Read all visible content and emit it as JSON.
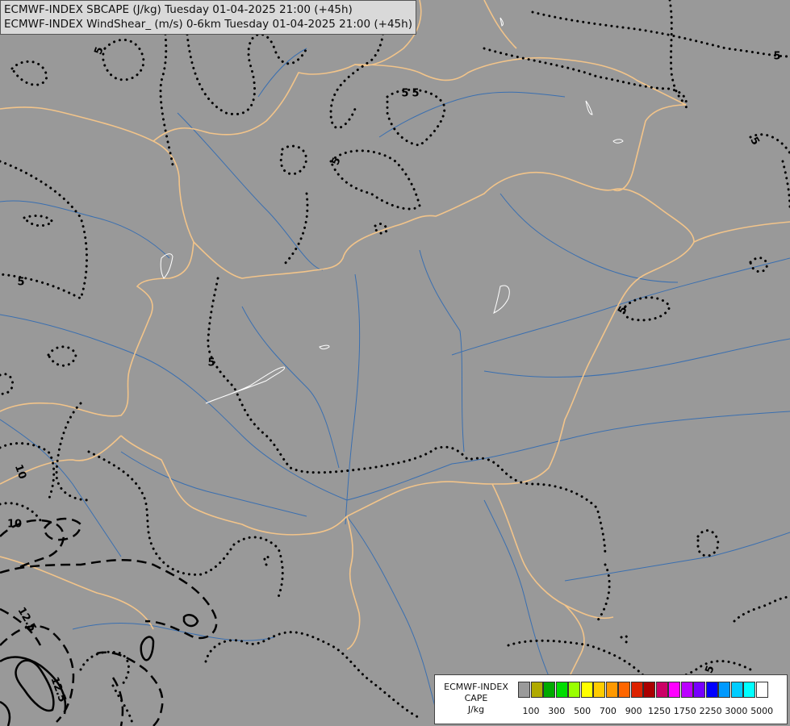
{
  "header": {
    "line1": "ECMWF-INDEX SBCAPE (J/kg) Tuesday 01-04-2025 21:00 (+45h)",
    "line2": "ECMWF-INDEX WindShear_ (m/s) 0-6km Tuesday 01-04-2025 21:00 (+45h)"
  },
  "legend": {
    "line1": "ECMWF-INDEX",
    "line2": "CAPE",
    "line3": "J/kg",
    "colors": [
      "#9a9a9a",
      "#b0aa00",
      "#00aa00",
      "#00dd00",
      "#99ff00",
      "#ffff00",
      "#ffcc00",
      "#ff9900",
      "#ff6600",
      "#dd2200",
      "#aa0000",
      "#cc0066",
      "#ff00ff",
      "#bb00ff",
      "#7700ff",
      "#0000ff",
      "#0099ff",
      "#00ccff",
      "#00ffff",
      "#ffffff"
    ],
    "ticks": [
      "100",
      "300",
      "500",
      "700",
      "900",
      "1250",
      "1750",
      "2250",
      "3000",
      "5000"
    ]
  },
  "contour_labels": [
    "5",
    "5",
    "5",
    "5",
    "5",
    "5",
    "5",
    "5",
    "5",
    "10",
    "10",
    "12.5",
    "12.5",
    "5"
  ],
  "colors": {
    "background": "#999999",
    "border": "#f2c48a",
    "river": "#3a6fb0",
    "contour": "#000000",
    "lake": "#ffffff"
  }
}
